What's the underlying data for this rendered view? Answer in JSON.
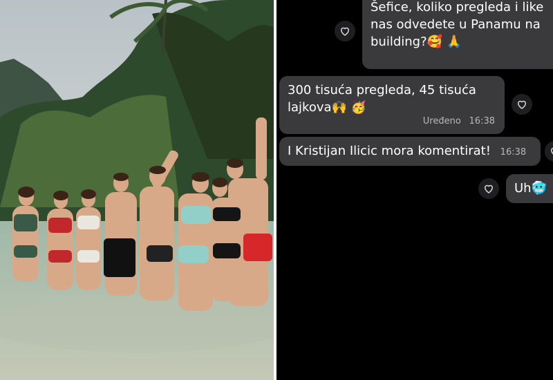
{
  "chat": {
    "messages": [
      {
        "lines": [
          "Šefice, koliko pregleda i like",
          "nas odvedete u Panamu na",
          "building?🥰 🙏"
        ]
      },
      {
        "lines": [
          "300 tisuća pregleda, 45 tisuća",
          "lajkova🙌 🥳"
        ],
        "status": "Uređeno",
        "time": "16:38"
      },
      {
        "lines": [
          "I Kristijan Ilicic mora komentirat!"
        ],
        "time": "16:38"
      },
      {
        "lines": [
          "Uh🥶"
        ]
      }
    ]
  },
  "icons": {
    "reaction": "heart-icon"
  },
  "colors": {
    "bubble": "#3a3a3c",
    "background": "#000000",
    "divider": "#ffffff"
  }
}
